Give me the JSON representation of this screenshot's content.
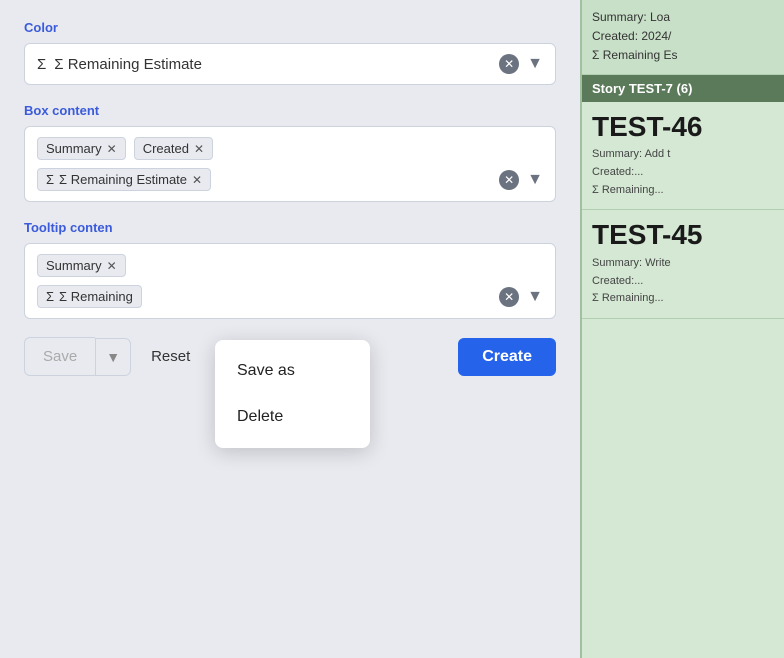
{
  "left": {
    "color_label": "Color",
    "color_value": "Σ Remaining Estimate",
    "box_content_label": "Box content",
    "box_tags": [
      "Summary",
      "Created"
    ],
    "box_tag_sigma": "Σ Remaining Estimate",
    "tooltip_label": "Tooltip conten",
    "tooltip_tags": [
      "Summary"
    ],
    "tooltip_sigma": "Σ Remaining",
    "save_label": "Save",
    "reset_label": "Reset",
    "create_label": "Create",
    "dropdown": {
      "save_as": "Save as",
      "delete": "Delete"
    }
  },
  "right": {
    "top_summary": "Summary: Loa",
    "top_created": "Created: 2024/",
    "top_sigma": "Σ Remaining Es",
    "story_header": "Story TEST-7 (6)",
    "card1_id": "TEST-46",
    "card1_summary": "Summary: Add t",
    "card1_created": "Created:...",
    "card1_sigma": "Σ Remaining...",
    "card2_id": "TEST-45",
    "card2_summary": "Summary: Write",
    "card2_created": "Created:...",
    "card2_sigma": "Σ Remaining..."
  }
}
